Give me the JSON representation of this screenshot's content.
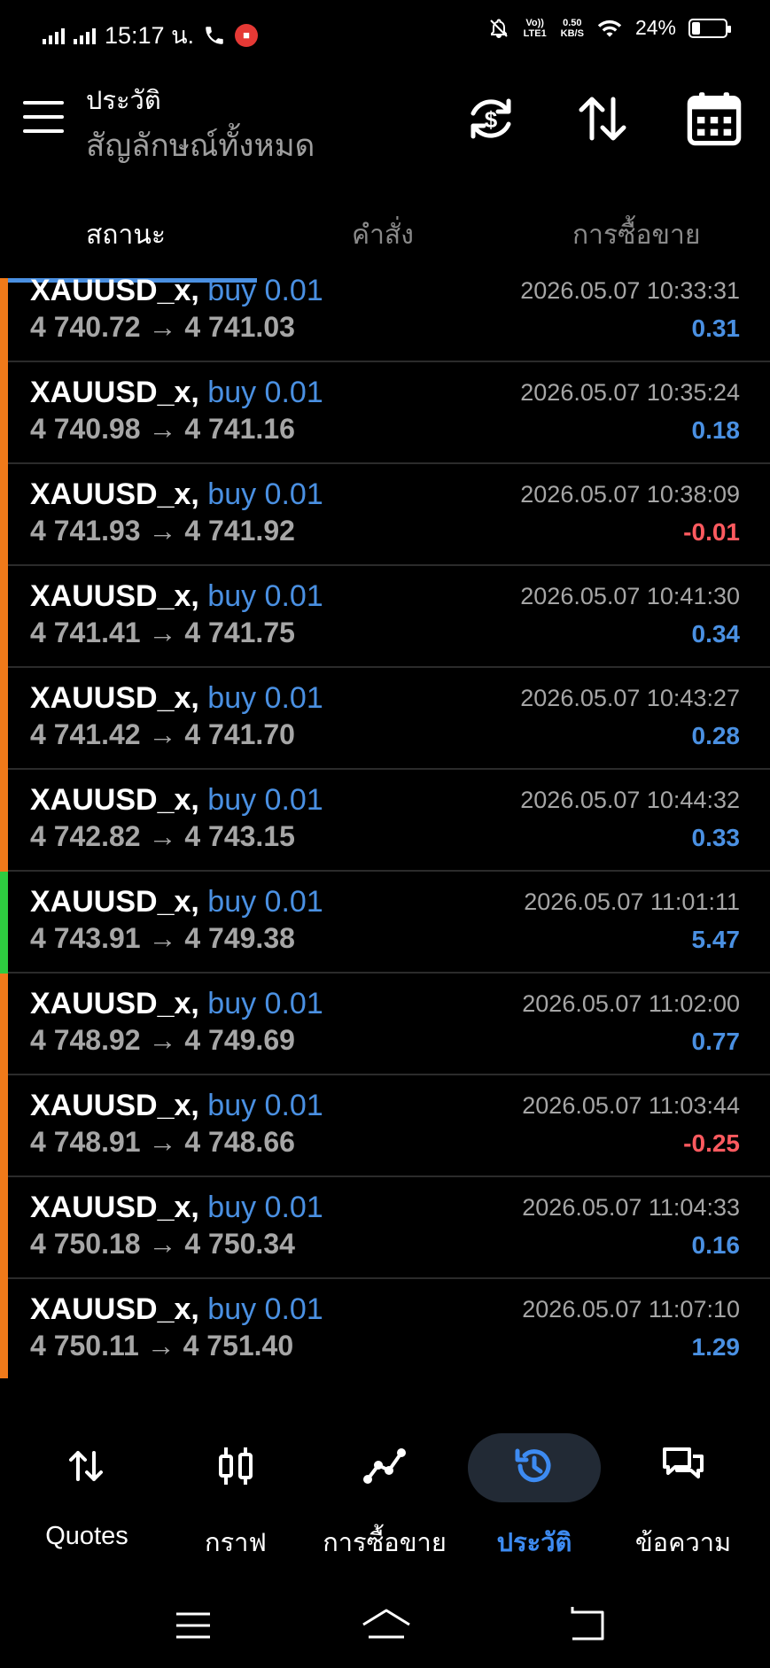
{
  "status_bar": {
    "time": "15:17 น.",
    "data_rate_value": "0.50",
    "data_rate_unit": "KB/S",
    "volte": "Vo)) LTE1",
    "battery": "24%",
    "battery_level": 0.24
  },
  "header": {
    "title": "ประวัติ",
    "subtitle": "สัญลักษณ์ทั้งหมด"
  },
  "tabs": [
    {
      "label": "สถานะ",
      "active": true
    },
    {
      "label": "คำสั่ง",
      "active": false
    },
    {
      "label": "การซื้อขาย",
      "active": false
    }
  ],
  "colors": {
    "accent_blue": "#4a90e2",
    "profit_blue": "#4a90e2",
    "loss_red": "#ff5a5f",
    "bar_orange": "#f07a1a",
    "bar_green": "#2ecc40"
  },
  "trades": [
    {
      "symbol": "XAUUSD_x,",
      "side": "buy 0.01",
      "open": "4 740.72",
      "close": "4 741.03",
      "time": "2026.05.07 10:33:31",
      "profit": "0.31",
      "positive": true,
      "bar": "orange"
    },
    {
      "symbol": "XAUUSD_x,",
      "side": "buy 0.01",
      "open": "4 740.98",
      "close": "4 741.16",
      "time": "2026.05.07 10:35:24",
      "profit": "0.18",
      "positive": true,
      "bar": "orange"
    },
    {
      "symbol": "XAUUSD_x,",
      "side": "buy 0.01",
      "open": "4 741.93",
      "close": "4 741.92",
      "time": "2026.05.07 10:38:09",
      "profit": "-0.01",
      "positive": false,
      "bar": "orange"
    },
    {
      "symbol": "XAUUSD_x,",
      "side": "buy 0.01",
      "open": "4 741.41",
      "close": "4 741.75",
      "time": "2026.05.07 10:41:30",
      "profit": "0.34",
      "positive": true,
      "bar": "orange"
    },
    {
      "symbol": "XAUUSD_x,",
      "side": "buy 0.01",
      "open": "4 741.42",
      "close": "4 741.70",
      "time": "2026.05.07 10:43:27",
      "profit": "0.28",
      "positive": true,
      "bar": "orange"
    },
    {
      "symbol": "XAUUSD_x,",
      "side": "buy 0.01",
      "open": "4 742.82",
      "close": "4 743.15",
      "time": "2026.05.07 10:44:32",
      "profit": "0.33",
      "positive": true,
      "bar": "orange"
    },
    {
      "symbol": "XAUUSD_x,",
      "side": "buy 0.01",
      "open": "4 743.91",
      "close": "4 749.38",
      "time": "2026.05.07 11:01:11",
      "profit": "5.47",
      "positive": true,
      "bar": "green"
    },
    {
      "symbol": "XAUUSD_x,",
      "side": "buy 0.01",
      "open": "4 748.92",
      "close": "4 749.69",
      "time": "2026.05.07 11:02:00",
      "profit": "0.77",
      "positive": true,
      "bar": "orange"
    },
    {
      "symbol": "XAUUSD_x,",
      "side": "buy 0.01",
      "open": "4 748.91",
      "close": "4 748.66",
      "time": "2026.05.07 11:03:44",
      "profit": "-0.25",
      "positive": false,
      "bar": "orange"
    },
    {
      "symbol": "XAUUSD_x,",
      "side": "buy 0.01",
      "open": "4 750.18",
      "close": "4 750.34",
      "time": "2026.05.07 11:04:33",
      "profit": "0.16",
      "positive": true,
      "bar": "orange"
    },
    {
      "symbol": "XAUUSD_x,",
      "side": "buy 0.01",
      "open": "4 750.11",
      "close": "4 751.40",
      "time": "2026.05.07 11:07:10",
      "profit": "1.29",
      "positive": true,
      "bar": "orange"
    }
  ],
  "arrow": "→",
  "bottom_nav": [
    {
      "label": "Quotes",
      "icon": "quotes-icon",
      "active": false
    },
    {
      "label": "กราฟ",
      "icon": "chart-icon",
      "active": false
    },
    {
      "label": "การซื้อขาย",
      "icon": "trade-icon",
      "active": false
    },
    {
      "label": "ประวัติ",
      "icon": "history-icon",
      "active": true
    },
    {
      "label": "ข้อความ",
      "icon": "messages-icon",
      "active": false
    }
  ]
}
